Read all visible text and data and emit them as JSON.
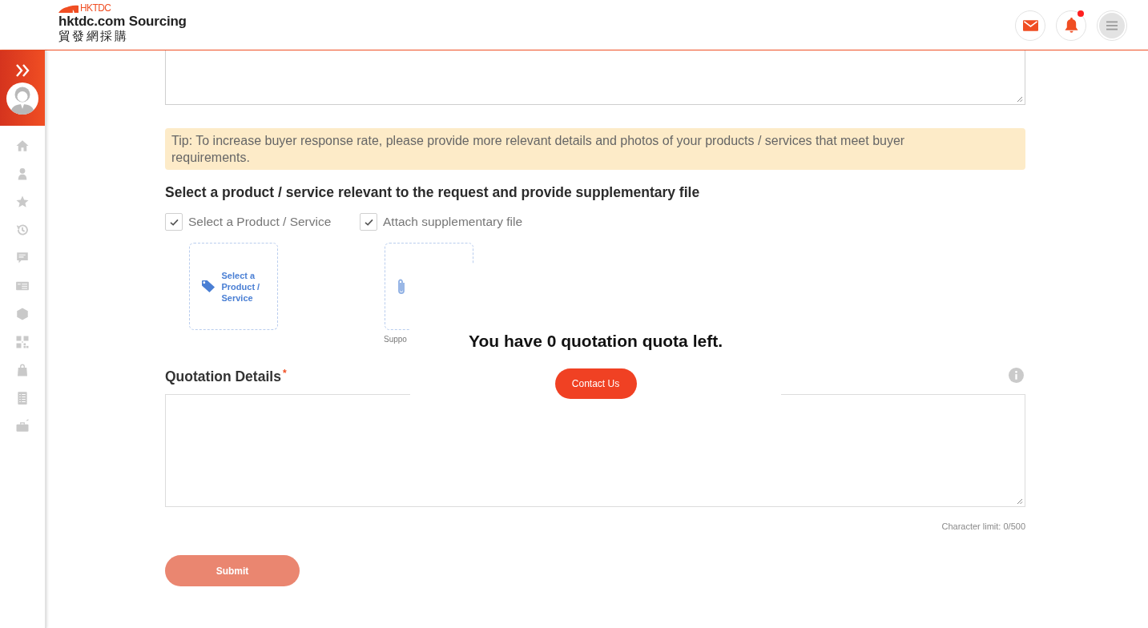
{
  "header": {
    "logo": {
      "mark": "HKTDC",
      "title": "hktdc.com Sourcing",
      "subtitle": "貿發網採購"
    },
    "actions": [
      {
        "kind": "mail",
        "badge": false
      },
      {
        "kind": "notifications",
        "badge": true
      },
      {
        "kind": "menu",
        "badge": false
      }
    ]
  },
  "sidebar": {
    "items": [
      {
        "kind": "home"
      },
      {
        "kind": "profile"
      },
      {
        "kind": "favourites"
      },
      {
        "kind": "history"
      },
      {
        "kind": "messages"
      },
      {
        "kind": "card"
      },
      {
        "kind": "products"
      },
      {
        "kind": "qr"
      },
      {
        "kind": "bag"
      },
      {
        "kind": "checklist"
      },
      {
        "kind": "briefcase"
      }
    ]
  },
  "form": {
    "tip": "Tip: To increase buyer response rate, please provide more relevant details and photos of your products / services that meet buyer requirements.",
    "section_heading": "Select a product / service relevant to the request and provide supplementary file",
    "options": [
      {
        "label": "Select a Product / Service",
        "checked": true,
        "card": {
          "kind": "product",
          "label": "Select a Product / Service"
        }
      },
      {
        "label": "Attach supplementary file",
        "checked": true,
        "card": {
          "kind": "file",
          "caption": "Suppo"
        }
      }
    ],
    "quotation_details": {
      "label": "Quotation Details",
      "required_mark": "*",
      "character_limit": "Character limit: 0/500"
    },
    "submit": {
      "label": "Submit",
      "disabled": true
    }
  },
  "modal": {
    "message": "You have 0 quotation quota left.",
    "button": "Contact Us"
  }
}
